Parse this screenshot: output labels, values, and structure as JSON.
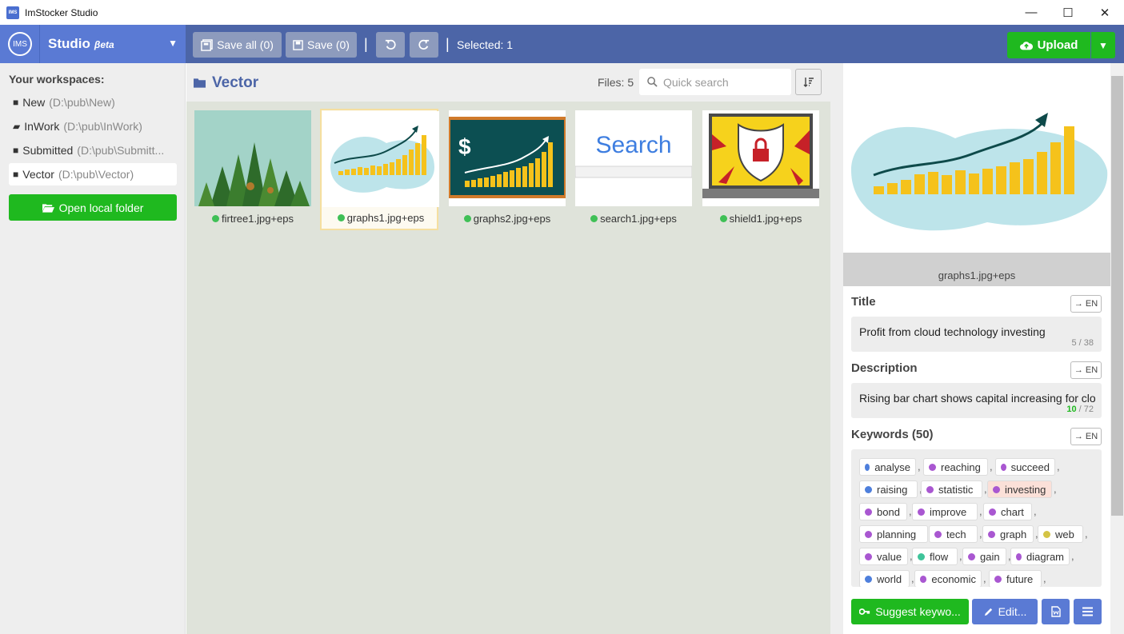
{
  "window": {
    "title": "ImStocker Studio"
  },
  "header": {
    "logo": "IMS",
    "studio": "Studio",
    "beta": "βeta",
    "save_all": "Save all (0)",
    "save": "Save (0)",
    "selected": "Selected: 1",
    "upload": "Upload"
  },
  "sidebar": {
    "label": "Your workspaces:",
    "items": [
      {
        "name": "New",
        "path": "(D:\\pub\\New)"
      },
      {
        "name": "InWork",
        "path": "(D:\\pub\\InWork)"
      },
      {
        "name": "Submitted",
        "path": "(D:\\pub\\Submitt..."
      },
      {
        "name": "Vector",
        "path": "(D:\\pub\\Vector)"
      }
    ],
    "open_local": "Open local folder"
  },
  "main": {
    "folder": "Vector",
    "files": "Files: 5",
    "search_placeholder": "Quick search",
    "thumbs": [
      {
        "caption": "firtree1.jpg+eps"
      },
      {
        "caption": "graphs1.jpg+eps"
      },
      {
        "caption": "graphs2.jpg+eps"
      },
      {
        "caption": "search1.jpg+eps"
      },
      {
        "caption": "shield1.jpg+eps"
      }
    ],
    "search_thumb_text": "Search",
    "dollar_text": "$"
  },
  "details": {
    "preview_caption": "graphs1.jpg+eps",
    "title_label": "Title",
    "title_value": "Profit from cloud technology investing",
    "title_count": "5 / 38",
    "desc_label": "Description",
    "desc_value": "Rising bar chart shows capital increasing for clo",
    "desc_count_ok": "10",
    "desc_count_max": " / 72",
    "en": "→ EN",
    "keywords_label": "Keywords (50)",
    "keywords": [
      {
        "word": "analyse",
        "color": "#4e7fdc"
      },
      {
        "word": "reaching",
        "color": "#a957d1"
      },
      {
        "word": "succeed",
        "color": "#a957d1"
      },
      {
        "word": "raising",
        "color": "#4e7fdc"
      },
      {
        "word": "statistic",
        "color": "#a957d1"
      },
      {
        "word": "investing",
        "color": "#a957d1"
      },
      {
        "word": "bond",
        "color": "#a957d1"
      },
      {
        "word": "improve",
        "color": "#a957d1"
      },
      {
        "word": "chart",
        "color": "#a957d1"
      },
      {
        "word": "planning",
        "color": "#a957d1"
      },
      {
        "word": "tech",
        "color": "#a957d1"
      },
      {
        "word": "graph",
        "color": "#a957d1"
      },
      {
        "word": "web",
        "color": "#d4c445"
      },
      {
        "word": "value",
        "color": "#a957d1"
      },
      {
        "word": "flow",
        "color": "#3fc49a"
      },
      {
        "word": "gain",
        "color": "#a957d1"
      },
      {
        "word": "diagram",
        "color": "#a957d1"
      },
      {
        "word": "world",
        "color": "#4e7fdc"
      },
      {
        "word": "economic",
        "color": "#a957d1"
      },
      {
        "word": "future",
        "color": "#a957d1"
      }
    ],
    "suggest": "Suggest keywo...",
    "edit": "Edit..."
  }
}
